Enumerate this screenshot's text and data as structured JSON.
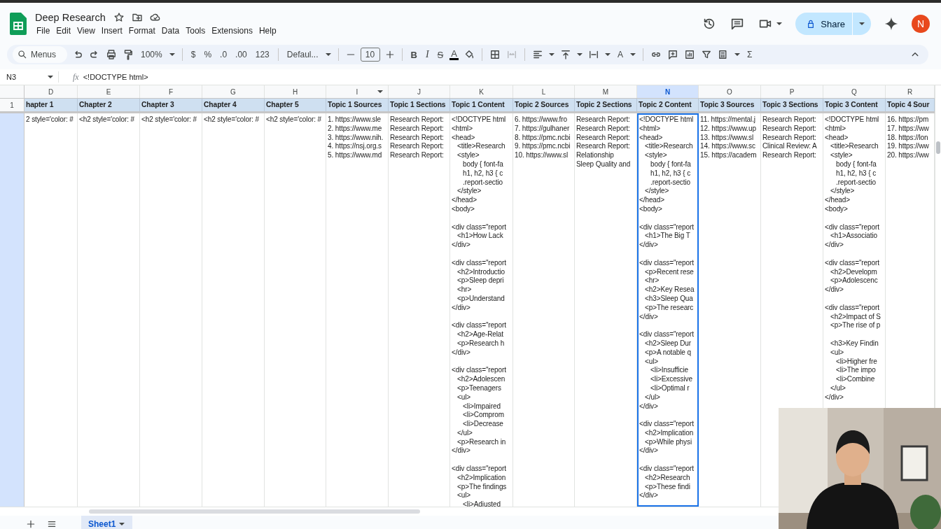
{
  "document": {
    "title": "Deep Research"
  },
  "menu": [
    "File",
    "Edit",
    "View",
    "Insert",
    "Format",
    "Data",
    "Tools",
    "Extensions",
    "Help"
  ],
  "header_actions": {
    "share": "Share",
    "avatar": "N"
  },
  "toolbar": {
    "search_placeholder": "Menus",
    "zoom": "100%",
    "currency": "$",
    "percent": "%",
    "decimals_down": ".0",
    "decimals_up": ".00",
    "number_format": "123",
    "font": "Defaul...",
    "font_size": "10",
    "bold": "B",
    "italic": "I",
    "strikethrough": "S",
    "text_color": "A",
    "text_rotation": "A",
    "functions": "Σ"
  },
  "formula_bar": {
    "cell": "N3",
    "fx": "fx",
    "value": "<!DOCTYPE html>"
  },
  "sheet": {
    "row_number": "1",
    "columns": [
      {
        "letter": "D",
        "header": "hapter 1",
        "selected": false,
        "has_menu": false,
        "cell": "2 style='color: #"
      },
      {
        "letter": "E",
        "header": "Chapter 2",
        "selected": false,
        "has_menu": false,
        "cell": "<h2 style='color: #"
      },
      {
        "letter": "F",
        "header": "Chapter 3",
        "selected": false,
        "has_menu": false,
        "cell": "<h2 style='color: #"
      },
      {
        "letter": "G",
        "header": "Chapter 4",
        "selected": false,
        "has_menu": false,
        "cell": "<h2 style='color: #"
      },
      {
        "letter": "H",
        "header": "Chapter 5",
        "selected": false,
        "has_menu": false,
        "cell": "<h2 style='color: #"
      },
      {
        "letter": "I",
        "header": "Topic 1 Sources",
        "selected": false,
        "has_menu": true,
        "cell": "1. https://www.sle\n2. https://www.me\n3. https://www.nih.\n4. https://nsj.org.s\n5. https://www.md"
      },
      {
        "letter": "J",
        "header": "Topic 1 Sections",
        "selected": false,
        "has_menu": false,
        "cell": "Research Report:\nResearch Report:\nResearch Report:\nResearch Report:\nResearch Report:"
      },
      {
        "letter": "K",
        "header": "Topic 1 Content",
        "selected": false,
        "has_menu": false,
        "cell": "<!DOCTYPE html\n<html>\n<head>\n   <title>Research\n   <style>\n      body { font-fa\n      h1, h2, h3 { c\n      .report-sectio\n   </style>\n</head>\n<body>\n\n<div class=\"report\n   <h1>How Lack\n</div>\n\n<div class=\"report\n   <h2>Introductio\n   <p>Sleep depri\n   <hr>\n   <p>Understand\n</div>\n\n<div class=\"report\n   <h2>Age-Relat\n   <p>Research h\n</div>\n\n<div class=\"report\n   <h2>Adolescen\n   <p>Teenagers\n   <ul>\n      <li>Impaired\n      <li>Comprom\n      <li>Decrease\n   </ul>\n   <p>Research in\n</div>\n\n<div class=\"report\n   <h2>Implication\n   <p>The findings\n   <ul>\n      <li>Adjusted"
      },
      {
        "letter": "L",
        "header": "Topic 2 Sources",
        "selected": false,
        "has_menu": false,
        "cell": "6. https://www.fro\n7. https://gulhaner\n8. https://pmc.ncbi\n9. https://pmc.ncbi\n10. https://www.sl"
      },
      {
        "letter": "M",
        "header": "Topic 2 Sections",
        "selected": false,
        "has_menu": false,
        "cell": "Research Report:\nResearch Report:\nResearch Report:\nResearch Report:\nRelationship\nSleep Quality and"
      },
      {
        "letter": "N",
        "header": "Topic 2 Content",
        "selected": true,
        "has_menu": false,
        "cell": "<!DOCTYPE html\n<html>\n<head>\n   <title>Research\n   <style>\n      body { font-fa\n      h1, h2, h3 { c\n      .report-sectio\n   </style>\n</head>\n<body>\n\n<div class=\"report\n   <h1>The Big T\n</div>\n\n<div class=\"report\n   <p>Recent rese\n   <hr>\n   <h2>Key Resea\n   <h3>Sleep Qua\n   <p>The researc\n</div>\n\n<div class=\"report\n   <h2>Sleep Dur\n   <p>A notable q\n   <ul>\n      <li>Insufficie\n      <li>Excessive\n      <li>Optimal r\n   </ul>\n</div>\n\n<div class=\"report\n   <h2>Implication\n   <p>While physi\n</div>\n\n<div class=\"report\n   <h2>Research\n   <p>These findi\n</div>"
      },
      {
        "letter": "O",
        "header": "Topic 3 Sources",
        "selected": false,
        "has_menu": false,
        "cell": "11. https://mental.j\n12. https://www.up\n13. https://www.sl\n14. https://www.sc\n15. https://academ"
      },
      {
        "letter": "P",
        "header": "Topic 3 Sections",
        "selected": false,
        "has_menu": false,
        "cell": "Research Report:\nResearch Report:\nResearch Report:\nClinical Review: A\nResearch Report:"
      },
      {
        "letter": "Q",
        "header": "Topic 3 Content",
        "selected": false,
        "has_menu": false,
        "cell": "<!DOCTYPE html\n<html>\n<head>\n   <title>Research\n   <style>\n      body { font-fa\n      h1, h2, h3 { c\n      .report-sectio\n   </style>\n</head>\n<body>\n\n<div class=\"report\n   <h1>Associatio\n</div>\n\n<div class=\"report\n   <h2>Developm\n   <p>Adolescenc\n</div>\n\n<div class=\"report\n   <h2>Impact of S\n   <p>The rise of p\n\n   <h3>Key Findin\n   <ul>\n      <li>Higher fre\n      <li>The impo\n      <li>Combine\n   </ul>\n</div>"
      },
      {
        "letter": "R",
        "header": "Topic 4 Sour",
        "selected": false,
        "has_menu": false,
        "cell": "16. https://pm\n17. https://ww\n18. https://lon\n19. https://ww\n20. https://ww"
      }
    ]
  },
  "sheet_tabs": [
    {
      "label": "Sheet1",
      "selected": true
    }
  ]
}
